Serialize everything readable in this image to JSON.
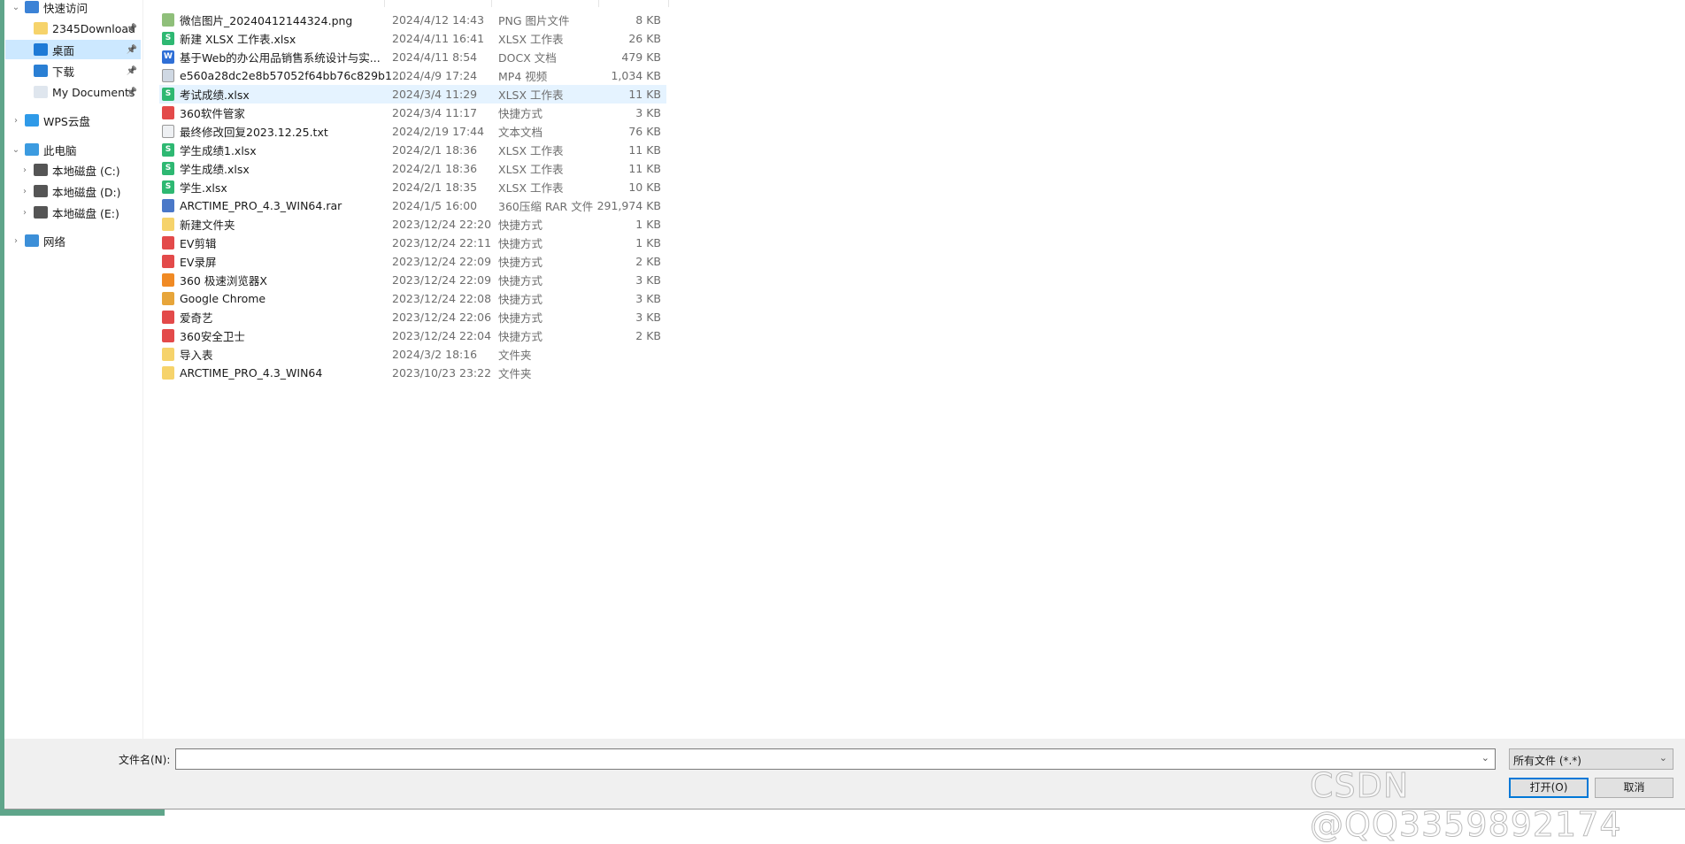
{
  "sidebar": {
    "items": [
      {
        "label": "快速访问",
        "icon": "star-icon",
        "expanded": true
      },
      {
        "label": "2345Download",
        "icon": "folder-icon",
        "pinned": true
      },
      {
        "label": "桌面",
        "icon": "desktop-icon",
        "pinned": true,
        "selected": true
      },
      {
        "label": "下载",
        "icon": "download-icon",
        "pinned": true
      },
      {
        "label": "My Documents",
        "icon": "document-icon",
        "pinned": true
      },
      {
        "label": "WPS云盘",
        "icon": "cloud-icon",
        "expanded": false
      },
      {
        "label": "此电脑",
        "icon": "computer-icon",
        "expanded": true
      },
      {
        "label": "本地磁盘 (C:)",
        "icon": "drive-icon",
        "expanded": false
      },
      {
        "label": "本地磁盘 (D:)",
        "icon": "drive-icon",
        "expanded": false
      },
      {
        "label": "本地磁盘 (E:)",
        "icon": "drive-icon",
        "expanded": false
      },
      {
        "label": "网络",
        "icon": "network-icon",
        "expanded": false
      }
    ]
  },
  "files": [
    {
      "name": "微信图片_20240412144324.png",
      "date": "2024/4/12 14:43",
      "type": "PNG 图片文件",
      "size": "8 KB",
      "icon": "image-icon"
    },
    {
      "name": "新建 XLSX 工作表.xlsx",
      "date": "2024/4/11 16:41",
      "type": "XLSX 工作表",
      "size": "26 KB",
      "icon": "spreadsheet-icon"
    },
    {
      "name": "基于Web的办公用品销售系统设计与实...",
      "date": "2024/4/11 8:54",
      "type": "DOCX 文档",
      "size": "479 KB",
      "icon": "word-icon"
    },
    {
      "name": "e560a28dc2e8b57052f64bb76c829b1...",
      "date": "2024/4/9 17:24",
      "type": "MP4 视频",
      "size": "1,034 KB",
      "icon": "video-icon"
    },
    {
      "name": "考试成绩.xlsx",
      "date": "2024/3/4 11:29",
      "type": "XLSX 工作表",
      "size": "11 KB",
      "icon": "spreadsheet-icon",
      "hovered": true
    },
    {
      "name": "360软件管家",
      "date": "2024/3/4 11:17",
      "type": "快捷方式",
      "size": "3 KB",
      "icon": "app-shortcut-icon"
    },
    {
      "name": "最终修改回复2023.12.25.txt",
      "date": "2024/2/19 17:44",
      "type": "文本文档",
      "size": "76 KB",
      "icon": "text-file-icon"
    },
    {
      "name": "学生成绩1.xlsx",
      "date": "2024/2/1 18:36",
      "type": "XLSX 工作表",
      "size": "11 KB",
      "icon": "spreadsheet-icon"
    },
    {
      "name": "学生成绩.xlsx",
      "date": "2024/2/1 18:36",
      "type": "XLSX 工作表",
      "size": "11 KB",
      "icon": "spreadsheet-icon"
    },
    {
      "name": "学生.xlsx",
      "date": "2024/2/1 18:35",
      "type": "XLSX 工作表",
      "size": "10 KB",
      "icon": "spreadsheet-icon"
    },
    {
      "name": "ARCTIME_PRO_4.3_WIN64.rar",
      "date": "2024/1/5 16:00",
      "type": "360压缩 RAR 文件",
      "size": "291,974 KB",
      "icon": "archive-icon"
    },
    {
      "name": "新建文件夹",
      "date": "2023/12/24 22:20",
      "type": "快捷方式",
      "size": "1 KB",
      "icon": "folder-shortcut-icon"
    },
    {
      "name": "EV剪辑",
      "date": "2023/12/24 22:11",
      "type": "快捷方式",
      "size": "1 KB",
      "icon": "app-shortcut-icon"
    },
    {
      "name": "EV录屏",
      "date": "2023/12/24 22:09",
      "type": "快捷方式",
      "size": "2 KB",
      "icon": "app-shortcut-icon"
    },
    {
      "name": "360 极速浏览器X",
      "date": "2023/12/24 22:09",
      "type": "快捷方式",
      "size": "3 KB",
      "icon": "browser-icon"
    },
    {
      "name": "Google Chrome",
      "date": "2023/12/24 22:08",
      "type": "快捷方式",
      "size": "3 KB",
      "icon": "chrome-icon"
    },
    {
      "name": "爱奇艺",
      "date": "2023/12/24 22:06",
      "type": "快捷方式",
      "size": "3 KB",
      "icon": "app-shortcut-icon"
    },
    {
      "name": "360安全卫士",
      "date": "2023/12/24 22:04",
      "type": "快捷方式",
      "size": "2 KB",
      "icon": "app-shortcut-icon"
    },
    {
      "name": "导入表",
      "date": "2024/3/2 18:16",
      "type": "文件夹",
      "size": "",
      "icon": "folder-icon"
    },
    {
      "name": "ARCTIME_PRO_4.3_WIN64",
      "date": "2023/10/23 23:22",
      "type": "文件夹",
      "size": "",
      "icon": "folder-icon"
    }
  ],
  "bottom": {
    "filename_label": "文件名(N):",
    "filename_value": "",
    "filter_selected": "所有文件 (*.*)",
    "open_label": "打开(O)",
    "cancel_label": "取消"
  },
  "watermark": "CSDN @QQ3359892174",
  "colors": {
    "selection": "#cce8ff",
    "hover": "#e5f3ff",
    "accent": "#0078d7",
    "window_edge": "#5fa58a"
  }
}
